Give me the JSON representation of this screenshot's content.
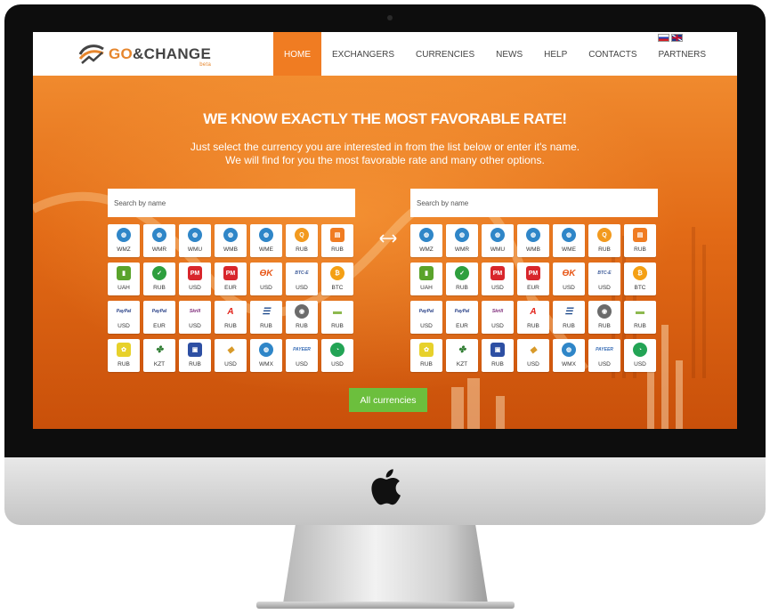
{
  "brand": {
    "name_part1": "GO",
    "name_part2": "&CHANGE",
    "badge": "beta"
  },
  "nav": [
    "HOME",
    "EXCHANGERS",
    "CURRENCIES",
    "NEWS",
    "HELP",
    "CONTACTS",
    "PARTNERS"
  ],
  "active_nav": "HOME",
  "languages": [
    "ru",
    "en"
  ],
  "hero": {
    "title": "WE KNOW EXACTLY THE MOST FAVORABLE RATE!",
    "subtitle_line1": "Just select the currency you are interested in from the list below or enter it's name.",
    "subtitle_line2": "We will find for you the most favorable rate and many other options."
  },
  "search_placeholder": "Search by name",
  "currencies": [
    {
      "code": "WMZ",
      "icon": "webmoney-icon",
      "color": "#2f86c8",
      "glyph": "◍",
      "shape": "circle"
    },
    {
      "code": "WMR",
      "icon": "webmoney-icon",
      "color": "#2f86c8",
      "glyph": "◍",
      "shape": "circle"
    },
    {
      "code": "WMU",
      "icon": "webmoney-icon",
      "color": "#2f86c8",
      "glyph": "◍",
      "shape": "circle"
    },
    {
      "code": "WMB",
      "icon": "webmoney-icon",
      "color": "#2f86c8",
      "glyph": "◍",
      "shape": "circle"
    },
    {
      "code": "WME",
      "icon": "webmoney-icon",
      "color": "#2f86c8",
      "glyph": "◍",
      "shape": "circle"
    },
    {
      "code": "RUB",
      "icon": "qiwi-icon",
      "color": "#f29a1f",
      "glyph": "Q",
      "shape": "circle"
    },
    {
      "code": "RUB",
      "icon": "yandex-money-icon",
      "color": "#f07c22",
      "glyph": "▤",
      "shape": "sq"
    },
    {
      "code": "UAH",
      "icon": "privatbank-icon",
      "color": "#5aa32b",
      "glyph": "▮",
      "shape": "sq"
    },
    {
      "code": "RUB",
      "icon": "sberbank-icon",
      "color": "#2e9f3e",
      "glyph": "✓",
      "shape": "circle"
    },
    {
      "code": "USD",
      "icon": "perfect-money-icon",
      "color": "#d8262c",
      "glyph": "PM",
      "shape": "sq"
    },
    {
      "code": "EUR",
      "icon": "perfect-money-icon",
      "color": "#d8262c",
      "glyph": "PM",
      "shape": "sq"
    },
    {
      "code": "USD",
      "icon": "okpay-icon",
      "color": "#e85a1c",
      "glyph": "ƟK",
      "shape": "txt"
    },
    {
      "code": "USD",
      "icon": "btc-e-icon",
      "color": "#3b5998",
      "glyph": "BTC-E",
      "shape": "txt"
    },
    {
      "code": "BTC",
      "icon": "bitcoin-icon",
      "color": "#f4a014",
      "glyph": "₿",
      "shape": "circle"
    },
    {
      "code": "USD",
      "icon": "paypal-icon",
      "color": "#243c84",
      "glyph": "PayPal",
      "shape": "txt"
    },
    {
      "code": "EUR",
      "icon": "paypal-icon",
      "color": "#243c84",
      "glyph": "PayPal",
      "shape": "txt"
    },
    {
      "code": "USD",
      "icon": "skrill-icon",
      "color": "#7e2a79",
      "glyph": "Skrill",
      "shape": "txt"
    },
    {
      "code": "RUB",
      "icon": "alfa-bank-icon",
      "color": "#e2231a",
      "glyph": "A",
      "shape": "txt"
    },
    {
      "code": "RUB",
      "icon": "vtb-icon",
      "color": "#1e4a8c",
      "glyph": "☰",
      "shape": "txt"
    },
    {
      "code": "RUB",
      "icon": "moneygram-icon",
      "color": "#6b6b6b",
      "glyph": "◉",
      "shape": "circle"
    },
    {
      "code": "RUB",
      "icon": "bank-card-icon",
      "color": "#8db94f",
      "glyph": "▬",
      "shape": "txt"
    },
    {
      "code": "RUB",
      "icon": "contact-icon",
      "color": "#e7d12b",
      "glyph": "✿",
      "shape": "sq"
    },
    {
      "code": "KZT",
      "icon": "kazkom-icon",
      "color": "#2f7d32",
      "glyph": "✤",
      "shape": "txt"
    },
    {
      "code": "RUB",
      "icon": "unistream-icon",
      "color": "#2d4fa3",
      "glyph": "▣",
      "shape": "sq"
    },
    {
      "code": "USD",
      "icon": "cash-icon",
      "color": "#d89a2a",
      "glyph": "◆",
      "shape": "txt"
    },
    {
      "code": "WMX",
      "icon": "webmoney-icon",
      "color": "#2f86c8",
      "glyph": "◍",
      "shape": "circle"
    },
    {
      "code": "USD",
      "icon": "payeer-icon",
      "color": "#3b6fb6",
      "glyph": "PAYEER",
      "shape": "txt"
    },
    {
      "code": "USD",
      "icon": "chat-icon",
      "color": "#23a455",
      "glyph": "◔",
      "shape": "circle"
    }
  ],
  "all_currencies_button": "All currencies"
}
